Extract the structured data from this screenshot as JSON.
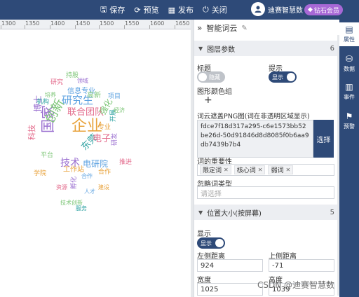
{
  "topbar": {
    "actions": [
      {
        "icon": "save-icon",
        "glyph": "🖫",
        "label": "保存"
      },
      {
        "icon": "preview-icon",
        "glyph": "⟳",
        "label": "预览"
      },
      {
        "icon": "publish-icon",
        "glyph": "▦",
        "label": "发布"
      },
      {
        "icon": "power-icon",
        "glyph": "⏻",
        "label": "关闭"
      }
    ],
    "user_name": "迪赛智慧数",
    "vip_label": "钻石会员"
  },
  "ruler": {
    "ticks": [
      "1300",
      "1350",
      "1400",
      "1450",
      "1500",
      "1550",
      "1600",
      "1650"
    ]
  },
  "wordcloud": [
    {
      "t": "企业",
      "c": "#e8a33d"
    },
    {
      "t": "国家",
      "c": "#9a6fd0"
    },
    {
      "t": "研究生",
      "c": "#5aa0e0"
    },
    {
      "t": "创新",
      "c": "#7cc576"
    },
    {
      "t": "联合团队",
      "c": "#e36b8c"
    },
    {
      "t": "技术",
      "c": "#9a6fd0"
    },
    {
      "t": "电研院",
      "c": "#5aa0e0"
    },
    {
      "t": "东莞",
      "c": "#2aa0a0"
    },
    {
      "t": "电子",
      "c": "#e36b8c"
    },
    {
      "t": "强化",
      "c": "#7cc576"
    },
    {
      "t": "工作站",
      "c": "#e8a33d"
    },
    {
      "t": "博士",
      "c": "#9a6fd0"
    },
    {
      "t": "信息专业",
      "c": "#5aa0e0"
    },
    {
      "t": "持股",
      "c": "#7cc576"
    },
    {
      "t": "科技",
      "c": "#e36b8c"
    },
    {
      "t": "机构",
      "c": "#2aa0a0"
    },
    {
      "t": "合作",
      "c": "#e8a33d"
    },
    {
      "t": "高新",
      "c": "#7cc576"
    },
    {
      "t": "研发",
      "c": "#9a6fd0"
    },
    {
      "t": "研究",
      "c": "#e36b8c"
    },
    {
      "t": "项目",
      "c": "#5aa0e0"
    },
    {
      "t": "平台",
      "c": "#7cc576"
    },
    {
      "t": "专业",
      "c": "#e8a33d"
    },
    {
      "t": "开展",
      "c": "#2aa0a0"
    },
    {
      "t": "推进",
      "c": "#e36b8c"
    },
    {
      "t": "领域",
      "c": "#9a6fd0"
    },
    {
      "t": "培养",
      "c": "#7cc576"
    },
    {
      "t": "合作",
      "c": "#5aa0e0"
    },
    {
      "t": "学院",
      "c": "#e8a33d"
    },
    {
      "t": "经济",
      "c": "#7cc576"
    },
    {
      "t": "资源",
      "c": "#e36b8c"
    },
    {
      "t": "孵化",
      "c": "#9a6fd0"
    },
    {
      "t": "人才",
      "c": "#5aa0e0"
    },
    {
      "t": "技术创新",
      "c": "#7cc576"
    },
    {
      "t": "建设",
      "c": "#e8a33d"
    },
    {
      "t": "服务",
      "c": "#2aa0a0"
    }
  ],
  "panel": {
    "title": "智能词云",
    "sections": [
      {
        "title": "图层参数",
        "count": "6"
      },
      {
        "title": "位置大小(按屏幕)",
        "count": "5"
      }
    ],
    "title_label": "标题",
    "title_toggle": "隐藏",
    "hint_label": "提示",
    "hint_toggle": "显示",
    "color_group_label": "图形颜色组",
    "mask_label": "词云遮盖PNG图(词在非透明区域显示)",
    "mask_value": "fdce7f18d317a295-c6e1573bb52be26d-50d91846d8d8085f0b6aa9db7439b7b4",
    "select_label": "选择",
    "importance_label": "词的重要性",
    "importance_tags": [
      "限定词",
      "核心词",
      "弱词"
    ],
    "ignore_label": "忽略词类型",
    "ignore_placeholder": "请选择",
    "show_label": "显示",
    "show_toggle": "显示",
    "left_label": "左侧距离",
    "left_value": "924",
    "top_label": "上侧距离",
    "top_value": "-71",
    "width_label": "宽度",
    "width_value": "1025",
    "height_label": "高度",
    "height_value": "1039"
  },
  "sidebar": [
    {
      "icon": "properties-icon",
      "glyph": "▤",
      "label": "属性"
    },
    {
      "icon": "data-icon",
      "glyph": "⛁",
      "label": "数据"
    },
    {
      "icon": "event-icon",
      "glyph": "▥",
      "label": "事件"
    },
    {
      "icon": "alert-icon",
      "glyph": "⚑",
      "label": "预警"
    }
  ],
  "watermark": "CSDN @迪赛智慧数"
}
